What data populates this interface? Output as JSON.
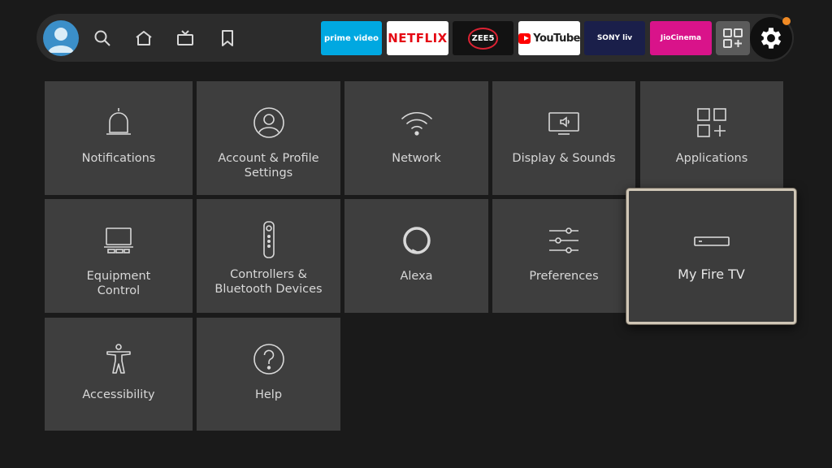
{
  "nav": {
    "items": [
      {
        "name": "search-icon"
      },
      {
        "name": "home-icon"
      },
      {
        "name": "live-tv-icon"
      },
      {
        "name": "bookmark-icon"
      }
    ],
    "apps": [
      {
        "label": "prime video",
        "bg": "#00a8e1",
        "fg": "#ffffff"
      },
      {
        "label": "NETFLIX",
        "bg": "#ffffff",
        "fg": "#e50914"
      },
      {
        "label": "ZEE5",
        "bg": "#121212",
        "fg": "#ffffff"
      },
      {
        "label": "YouTube",
        "bg": "#ffffff",
        "fg": "#212121"
      },
      {
        "label": "SONY liv",
        "bg": "#1a1f4a",
        "fg": "#ffffff"
      },
      {
        "label": "JioCinema",
        "bg": "#d9138a",
        "fg": "#ffffff"
      }
    ],
    "accent": "#f08a24"
  },
  "settings": {
    "tiles": [
      {
        "label": "Notifications",
        "icon": "bell-icon"
      },
      {
        "label": "Account & Profile Settings",
        "icon": "profile-icon"
      },
      {
        "label": "Network",
        "icon": "wifi-icon"
      },
      {
        "label": "Display & Sounds",
        "icon": "display-sound-icon"
      },
      {
        "label": "Applications",
        "icon": "applications-icon"
      },
      {
        "label": "Equipment Control",
        "icon": "equipment-icon"
      },
      {
        "label": "Controllers & Bluetooth Devices",
        "icon": "remote-icon"
      },
      {
        "label": "Alexa",
        "icon": "alexa-icon"
      },
      {
        "label": "Preferences",
        "icon": "sliders-icon"
      },
      {
        "label": "My Fire TV",
        "icon": "fire-tv-device-icon",
        "focused": true
      },
      {
        "label": "Accessibility",
        "icon": "accessibility-icon"
      },
      {
        "label": "Help",
        "icon": "help-icon"
      }
    ]
  }
}
